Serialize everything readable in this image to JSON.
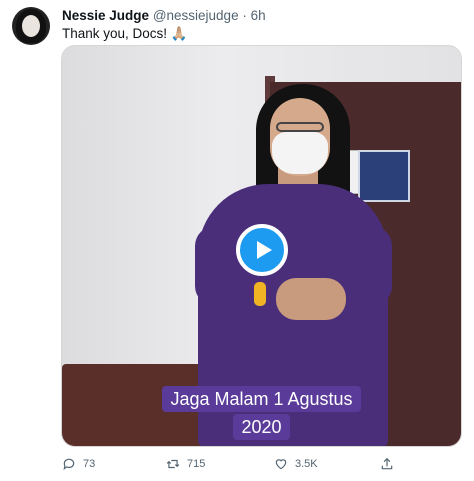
{
  "tweet": {
    "display_name": "Nessie Judge",
    "handle": "@nessiejudge",
    "separator": "·",
    "time": "6h",
    "text": "Thank you, Docs! 🙏🏼",
    "video_caption_line1": "Jaga Malam 1 Agustus",
    "video_caption_line2": "2020",
    "replies": "73",
    "retweets": "715",
    "likes": "3.5K"
  },
  "icons": {
    "reply": "reply-icon",
    "retweet": "retweet-icon",
    "like": "heart-icon",
    "share": "share-icon",
    "play": "play-icon"
  },
  "colors": {
    "accent": "#1d9bf0",
    "caption_bg": "#5a3b9a",
    "muted": "#536471"
  }
}
